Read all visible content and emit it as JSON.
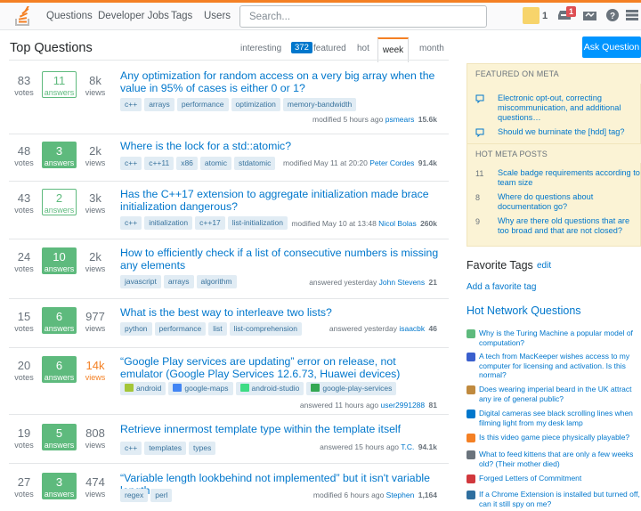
{
  "nav": {
    "questions": "Questions",
    "jobs": "Developer Jobs",
    "tags": "Tags",
    "users": "Users",
    "search_placeholder": "Search...",
    "reputation": "1",
    "inbox_count": "1"
  },
  "main": {
    "title": "Top Questions",
    "ask_label": "Ask Question",
    "tabs": {
      "interesting": "interesting",
      "featured_count": "372",
      "featured": "featured",
      "hot": "hot",
      "week": "week",
      "month": "month"
    }
  },
  "questions": [
    {
      "votes": "83",
      "votes_label": "votes",
      "answers": "11",
      "answers_label": "answers",
      "accepted": false,
      "views": "8k",
      "views_label": "views",
      "views_hot": false,
      "title": "Any optimization for random access on a very big array when the value in 95% of cases is either 0 or 1?",
      "tags": [
        "c++",
        "arrays",
        "performance",
        "optimization",
        "memory-bandwidth"
      ],
      "meta_action": "modified 5 hours ago",
      "user": "psmears",
      "rep": "15.6k"
    },
    {
      "votes": "48",
      "votes_label": "votes",
      "answers": "3",
      "answers_label": "answers",
      "accepted": true,
      "views": "2k",
      "views_label": "views",
      "views_hot": false,
      "title": "Where is the lock for a std::atomic?",
      "tags": [
        "c++",
        "c++11",
        "x86",
        "atomic",
        "stdatomic"
      ],
      "meta_action": "modified May 11 at 20:20",
      "user": "Peter Cordes",
      "rep": "91.4k"
    },
    {
      "votes": "43",
      "votes_label": "votes",
      "answers": "2",
      "answers_label": "answers",
      "accepted": false,
      "views": "3k",
      "views_label": "views",
      "views_hot": false,
      "title": "Has the C++17 extension to aggregate initialization made brace initialization dangerous?",
      "tags": [
        "c++",
        "initialization",
        "c++17",
        "list-initialization"
      ],
      "meta_action": "modified May 10 at 13:48",
      "user": "Nicol Bolas",
      "rep": "260k"
    },
    {
      "votes": "24",
      "votes_label": "votes",
      "answers": "10",
      "answers_label": "answers",
      "accepted": true,
      "views": "2k",
      "views_label": "views",
      "views_hot": false,
      "title": "How to efficiently check if a list of consecutive numbers is missing any elements",
      "tags": [
        "javascript",
        "arrays",
        "algorithm"
      ],
      "meta_action": "answered yesterday",
      "user": "John Stevens",
      "rep": "21"
    },
    {
      "votes": "15",
      "votes_label": "votes",
      "answers": "6",
      "answers_label": "answers",
      "accepted": true,
      "views": "977",
      "views_label": "views",
      "views_hot": false,
      "title": "What is the best way to interleave two lists?",
      "tags": [
        "python",
        "performance",
        "list",
        "list-comprehension"
      ],
      "meta_action": "answered yesterday",
      "user": "isaacbk",
      "rep": "46"
    },
    {
      "votes": "20",
      "votes_label": "votes",
      "answers": "6",
      "answers_label": "answers",
      "accepted": true,
      "views": "14k",
      "views_label": "views",
      "views_hot": true,
      "title": "“Google Play services are updating” error on release, not emulator (Google Play Services 12.6.73, Huawei devices)",
      "tags": [
        "android",
        "google-maps",
        "android-studio",
        "google-play-services"
      ],
      "meta_action": "answered 11 hours ago",
      "user": "user2991288",
      "rep": "81"
    },
    {
      "votes": "19",
      "votes_label": "votes",
      "answers": "5",
      "answers_label": "answers",
      "accepted": true,
      "views": "808",
      "views_label": "views",
      "views_hot": false,
      "title": "Retrieve innermost template type within the template itself",
      "tags": [
        "c++",
        "templates",
        "types"
      ],
      "meta_action": "answered 15 hours ago",
      "user": "T.C.",
      "rep": "94.1k"
    },
    {
      "votes": "27",
      "votes_label": "votes",
      "answers": "3",
      "answers_label": "answers",
      "accepted": true,
      "views": "474",
      "views_label": "views",
      "views_hot": false,
      "title": "“Variable length lookbehind not implemented” but it isn't variable length",
      "tags": [
        "regex",
        "perl"
      ],
      "meta_action": "modified 6 hours ago",
      "user": "Stephen",
      "rep": "1,164"
    }
  ],
  "sidebar": {
    "featured_meta_title": "FEATURED ON META",
    "featured_meta": [
      "Electronic opt-out, correcting miscommunication, and additional questions…",
      "Should we burninate the [hdd] tag?"
    ],
    "hot_meta_title": "HOT META POSTS",
    "hot_meta": [
      {
        "count": "11",
        "text": "Scale badge requirements according to team size"
      },
      {
        "count": "8",
        "text": "Where do questions about documentation go?"
      },
      {
        "count": "9",
        "text": "Why are there old questions that are too broad and that are not closed?"
      }
    ],
    "favorite_tags_title": "Favorite Tags",
    "favorite_tags_edit": "edit",
    "favorite_tags_add": "Add a favorite tag",
    "hnq_title": "Hot Network Questions",
    "hnq": [
      "Why is the Turing Machine a popular model of computation?",
      "A tech from MacKeeper wishes access to my computer for licensing and activation. Is this normal?",
      "Does wearing imperial beard in the UK attract any ire of general public?",
      "Digital cameras see black scrolling lines when filming light from my desk lamp",
      "Is this video game piece physically playable?",
      "What to feed kittens that are only a few weeks old? (Their mother died)",
      "Forged Letters of Commitment",
      "If a Chrome Extension is installed but turned off, can it still spy on me?"
    ]
  },
  "colors": {
    "accent": "#f48024",
    "link": "#0077cc",
    "accepted": "#5eba7d",
    "tag_bg": "#e1ecf4",
    "meta_bg": "#fbf3d5"
  }
}
